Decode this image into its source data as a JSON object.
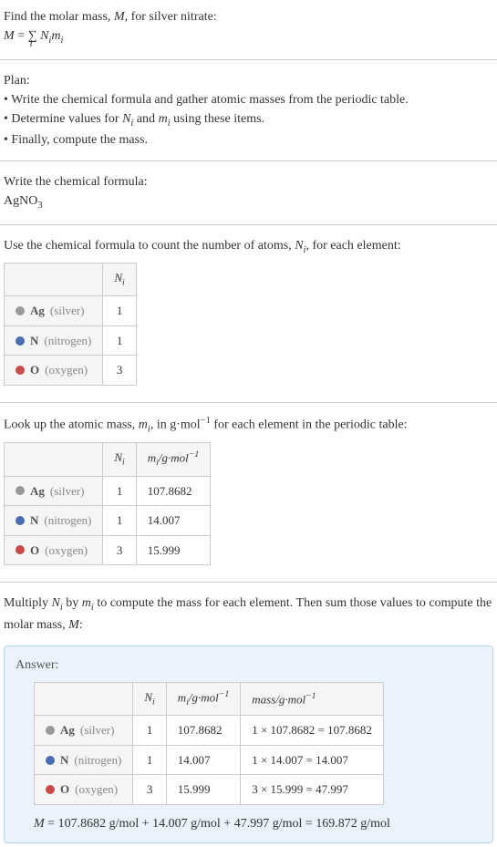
{
  "intro": {
    "line1_pre": "Find the molar mass, ",
    "line1_M": "M",
    "line1_post": ", for silver nitrate:",
    "eq_M": "M",
    "eq_equals": " = ",
    "eq_sum": "∑",
    "eq_sub": "i",
    "eq_Ni": "N",
    "eq_Ni_sub": "i",
    "eq_mi": "m",
    "eq_mi_sub": "i"
  },
  "plan": {
    "title": "Plan:",
    "b1_pre": "• Write the chemical formula and gather atomic masses from the periodic table.",
    "b2_pre": "• Determine values for ",
    "b2_Ni": "N",
    "b2_Ni_sub": "i",
    "b2_mid": " and ",
    "b2_mi": "m",
    "b2_mi_sub": "i",
    "b2_post": " using these items.",
    "b3": "• Finally, compute the mass."
  },
  "chemformula": {
    "title": "Write the chemical formula:",
    "Ag": "Ag",
    "N": "N",
    "O": "O",
    "sub3": "3"
  },
  "count": {
    "intro_pre": "Use the chemical formula to count the number of atoms, ",
    "intro_Ni": "N",
    "intro_Ni_sub": "i",
    "intro_post": ", for each element:",
    "header_Ni": "N",
    "header_Ni_sub": "i",
    "rows": [
      {
        "dot": "dot-ag",
        "symbol": "Ag",
        "name": "(silver)",
        "ni": "1"
      },
      {
        "dot": "dot-n",
        "symbol": "N",
        "name": "(nitrogen)",
        "ni": "1"
      },
      {
        "dot": "dot-o",
        "symbol": "O",
        "name": "(oxygen)",
        "ni": "3"
      }
    ]
  },
  "atomicmass": {
    "intro_pre": "Look up the atomic mass, ",
    "intro_mi": "m",
    "intro_mi_sub": "i",
    "intro_mid": ", in g·mol",
    "intro_sup": "−1",
    "intro_post": " for each element in the periodic table:",
    "header_Ni": "N",
    "header_Ni_sub": "i",
    "header_mi": "m",
    "header_mi_sub": "i",
    "header_unit": "/g·mol",
    "header_unit_sup": "−1",
    "rows": [
      {
        "dot": "dot-ag",
        "symbol": "Ag",
        "name": "(silver)",
        "ni": "1",
        "mi": "107.8682"
      },
      {
        "dot": "dot-n",
        "symbol": "N",
        "name": "(nitrogen)",
        "ni": "1",
        "mi": "14.007"
      },
      {
        "dot": "dot-o",
        "symbol": "O",
        "name": "(oxygen)",
        "ni": "3",
        "mi": "15.999"
      }
    ]
  },
  "multiply": {
    "intro_pre": "Multiply ",
    "intro_Ni": "N",
    "intro_Ni_sub": "i",
    "intro_mid1": " by ",
    "intro_mi": "m",
    "intro_mi_sub": "i",
    "intro_mid2": " to compute the mass for each element. Then sum those values to compute the molar mass, ",
    "intro_M": "M",
    "intro_post": ":"
  },
  "answer": {
    "label": "Answer:",
    "header_Ni": "N",
    "header_Ni_sub": "i",
    "header_mi": "m",
    "header_mi_sub": "i",
    "header_unit": "/g·mol",
    "header_unit_sup": "−1",
    "header_mass": "mass/g·mol",
    "header_mass_sup": "−1",
    "rows": [
      {
        "dot": "dot-ag",
        "symbol": "Ag",
        "name": "(silver)",
        "ni": "1",
        "mi": "107.8682",
        "mass": "1 × 107.8682 = 107.8682"
      },
      {
        "dot": "dot-n",
        "symbol": "N",
        "name": "(nitrogen)",
        "ni": "1",
        "mi": "14.007",
        "mass": "1 × 14.007 = 14.007"
      },
      {
        "dot": "dot-o",
        "symbol": "O",
        "name": "(oxygen)",
        "ni": "3",
        "mi": "15.999",
        "mass": "3 × 15.999 = 47.997"
      }
    ],
    "final_M": "M",
    "final_eq": " = 107.8682 g/mol + 14.007 g/mol + 47.997 g/mol = 169.872 g/mol"
  }
}
